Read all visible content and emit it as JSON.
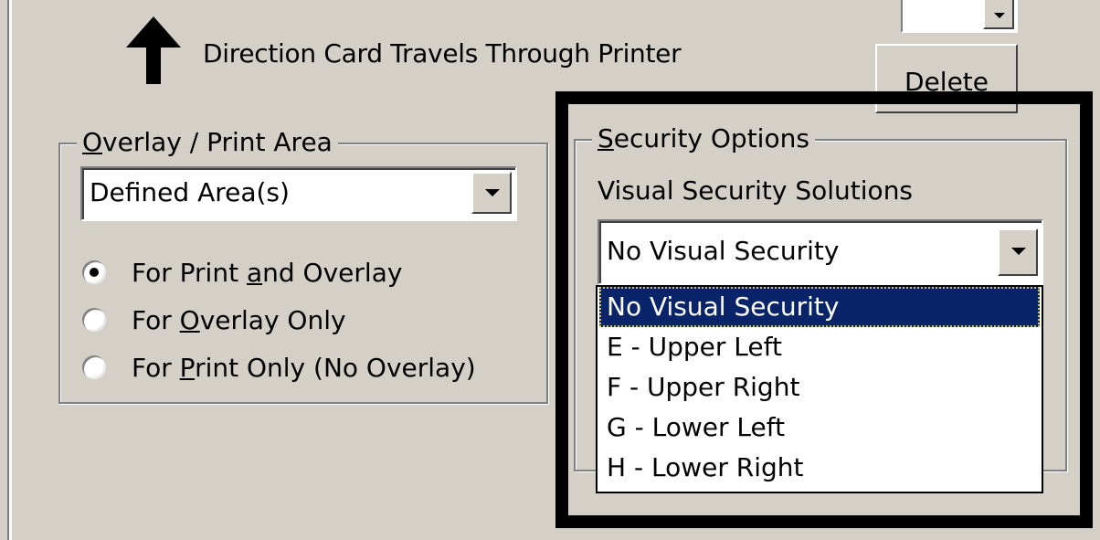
{
  "header": {
    "direction_label": "Direction Card Travels Through Printer",
    "arrow_icon": "up-arrow-icon"
  },
  "toolbar": {
    "delete_label": "Delete"
  },
  "overlay_group": {
    "title_underlined": "O",
    "title_rest": "verlay / Print Area",
    "combo_value": "Defined Area(s)",
    "radios": [
      {
        "pre": "For Print ",
        "underlined": "a",
        "post": "nd Overlay",
        "checked": true
      },
      {
        "pre": "For ",
        "underlined": "O",
        "post": "verlay Only",
        "checked": false
      },
      {
        "pre": "For ",
        "underlined": "P",
        "post": "rint Only (No Overlay)",
        "checked": false
      }
    ]
  },
  "security_group": {
    "title_underlined": "S",
    "title_rest": "ecurity Options",
    "visual_label": "Visual Security Solutions",
    "combo_value": "No Visual Security",
    "options": [
      "No Visual Security",
      "E - Upper Left",
      "F - Upper Right",
      "G - Lower Left",
      "H - Lower Right"
    ],
    "selected_index": 0
  },
  "colors": {
    "window_bg": "#d4d0c8",
    "highlight": "#0a246a",
    "frame": "#000000"
  }
}
